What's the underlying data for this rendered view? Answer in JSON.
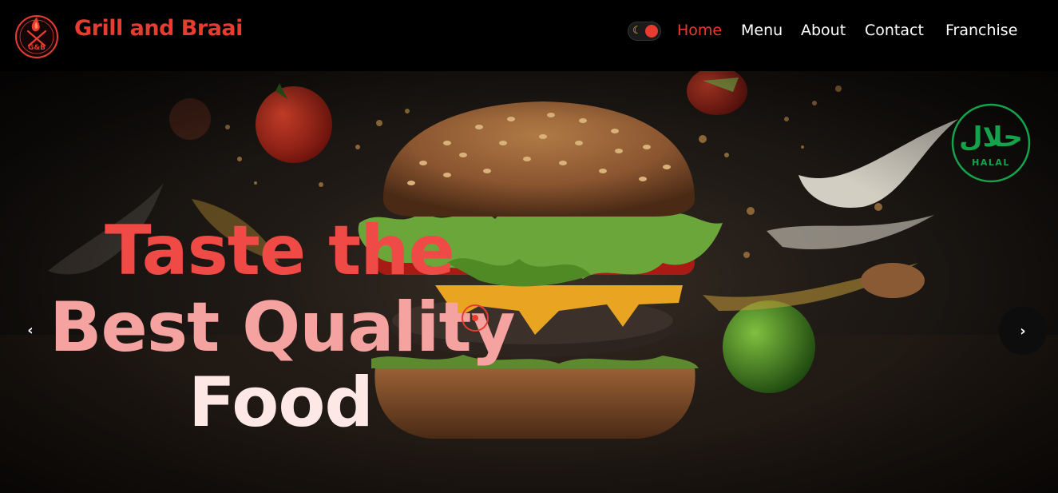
{
  "header": {
    "brand": "Grill and Braai",
    "logo_icon": "flame-crossed-utensils-logo",
    "logo_initials": "G&B",
    "theme_toggle": {
      "icon": "moon-icon",
      "state": "dark"
    },
    "nav": [
      {
        "label": "Home",
        "active": true
      },
      {
        "label": "Menu",
        "active": false
      },
      {
        "label": "About",
        "active": false
      },
      {
        "label": "Contact",
        "active": false
      },
      {
        "label": "Franchise",
        "active": false
      }
    ]
  },
  "hero": {
    "headline": [
      "Taste the",
      "Best Quality",
      "Food"
    ],
    "badge": {
      "arabic": "حلال",
      "label": "HALAL",
      "icon": "halal-badge-icon"
    },
    "prev_icon": "chevron-left-icon",
    "next_icon": "chevron-right-icon",
    "prev_glyph": "‹",
    "next_glyph": "›"
  },
  "colors": {
    "brand_red": "#e73c2f",
    "halal_green": "#14a34a",
    "background": "#000000"
  }
}
